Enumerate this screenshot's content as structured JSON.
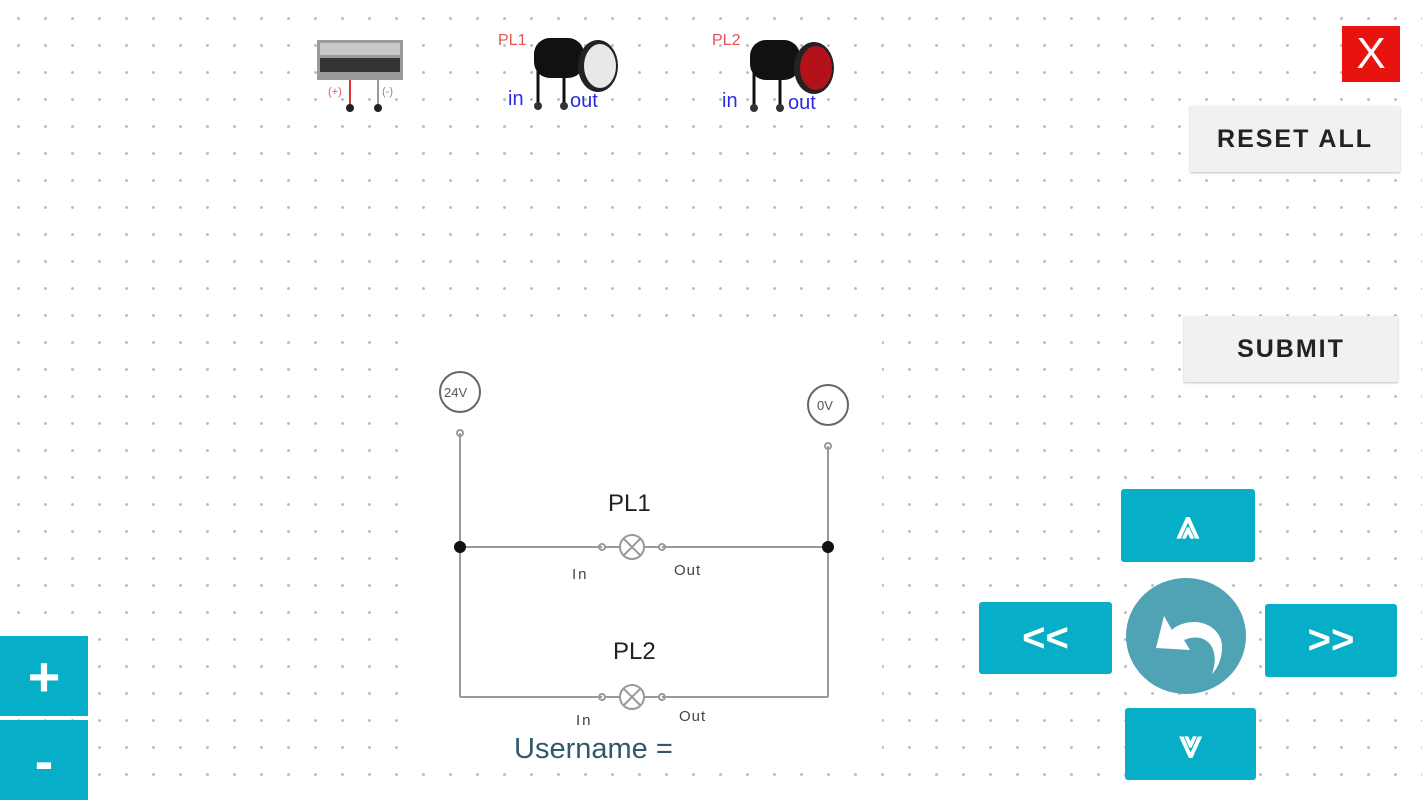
{
  "toolbox": {
    "psu": {
      "plus": "(+)",
      "minus": "(-)"
    },
    "pl1": {
      "label": "PL1",
      "in": "in",
      "out": "out",
      "lens_color": "#e8e8e8"
    },
    "pl2": {
      "label": "PL2",
      "in": "in",
      "out": "out",
      "lens_color": "#b3121b"
    }
  },
  "buttons": {
    "close": "X",
    "reset": "RESET ALL",
    "submit": "SUBMIT",
    "zoom_in": "+",
    "zoom_out": "-",
    "up": "⩓",
    "down": "⩔",
    "left": "<<",
    "right": ">>"
  },
  "circuit": {
    "supply_pos": "24V",
    "supply_neg": "0V",
    "lamp1": "PL1",
    "lamp2": "PL2",
    "in": "In",
    "out": "Out"
  },
  "username_label": "Username =",
  "colors": {
    "accent": "#07aec7",
    "close": "#e8120f",
    "undo": "#4fa3b5"
  }
}
